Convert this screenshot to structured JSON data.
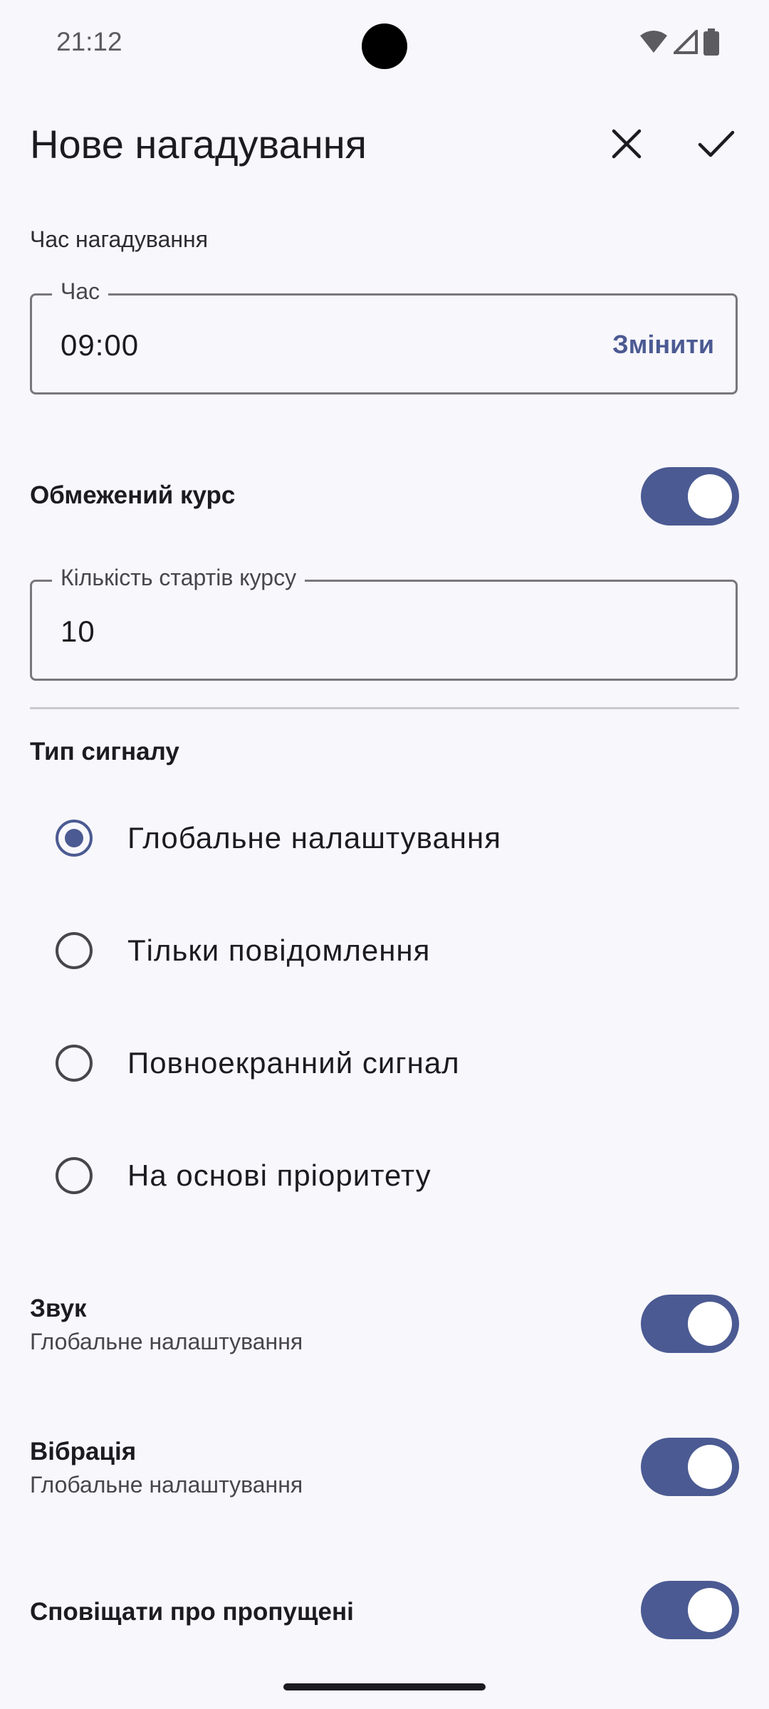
{
  "status": {
    "time": "21:12",
    "icons": [
      "wifi-icon",
      "signal-icon",
      "battery-icon"
    ]
  },
  "topbar": {
    "title": "Нове нагадування",
    "close_icon": "close-icon",
    "confirm_icon": "check-icon"
  },
  "time_section": {
    "caption": "Час нагадування",
    "field_label": "Час",
    "value": "09:00",
    "action": "Змінити"
  },
  "limited_course": {
    "title": "Обмежений курс",
    "enabled": true,
    "field_label": "Кількість стартів курсу",
    "value": "10"
  },
  "signal_type": {
    "title": "Тип сигналу",
    "options": [
      {
        "label": "Глобальне налаштування",
        "selected": true
      },
      {
        "label": "Тільки повідомлення",
        "selected": false
      },
      {
        "label": "Повноекранний сигнал",
        "selected": false
      },
      {
        "label": "На основі пріоритету",
        "selected": false
      }
    ]
  },
  "sound": {
    "title": "Звук",
    "subtitle": "Глобальне налаштування",
    "enabled": true
  },
  "vibration": {
    "title": "Вібрація",
    "subtitle": "Глобальне налаштування",
    "enabled": true
  },
  "missed": {
    "title": "Сповіщати про пропущені",
    "enabled": true
  },
  "colors": {
    "accent": "#4b5a92",
    "background": "#f8f7fc",
    "text": "#1c1b20"
  }
}
